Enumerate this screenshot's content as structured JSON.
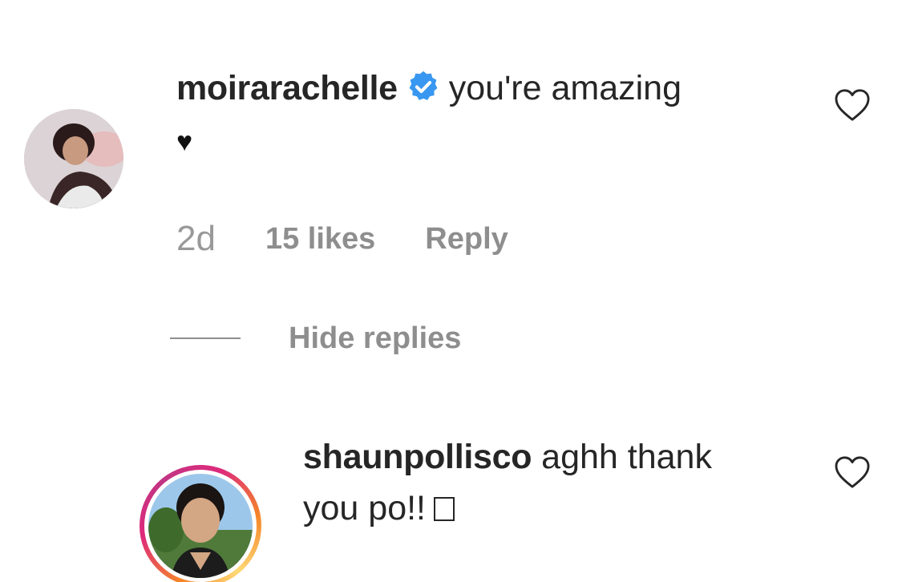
{
  "comment": {
    "username": "moirarachelle",
    "verified": true,
    "text": "you're amazing",
    "heart": "♥",
    "time": "2d",
    "likes": "15 likes",
    "reply_label": "Reply"
  },
  "replies_toggle": {
    "label": "Hide replies"
  },
  "reply": {
    "username": "shaunpollisco",
    "text_line1": "aghh thank",
    "text_line2": "you po!!",
    "emoji_box": "☐",
    "story_ring": true
  },
  "icons": {
    "verified": "verified-badge-icon",
    "like": "heart-outline-icon"
  },
  "colors": {
    "verified_blue": "#3897f0",
    "meta_gray": "#8e8e8e",
    "text": "#262626",
    "story_ring_start": "#f58529",
    "story_ring_end": "#dd2a7b"
  }
}
